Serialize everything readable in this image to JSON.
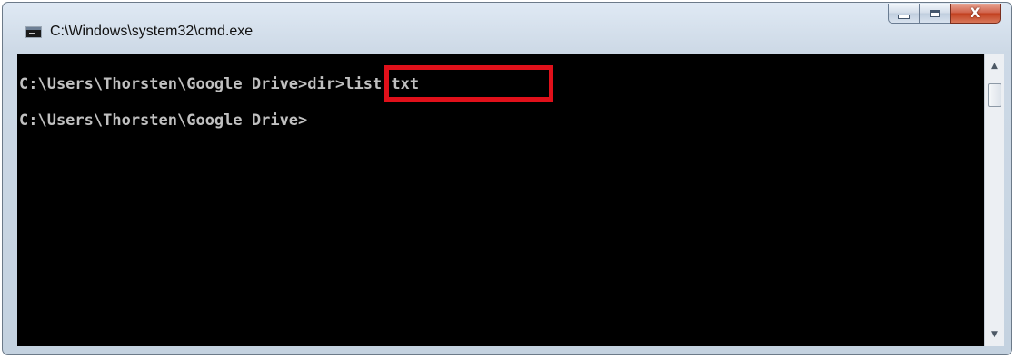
{
  "window": {
    "title": "C:\\Windows\\system32\\cmd.exe",
    "icon": "cmd-icon",
    "caption_buttons": {
      "minimize_icon": "minimize-icon",
      "maximize_icon": "maximize-icon",
      "close_icon": "close-icon",
      "close_glyph": "X"
    }
  },
  "console": {
    "background_color": "#000000",
    "text_color": "#c0c0c0",
    "lines": [
      "C:\\Users\\Thorsten\\Google Drive>dir>list.txt",
      "C:\\Users\\Thorsten\\Google Drive>"
    ],
    "highlight": {
      "text": "dir>list.txt",
      "color": "#e0101a"
    }
  },
  "scrollbar": {
    "up_arrow": "▲",
    "down_arrow": "▼"
  }
}
